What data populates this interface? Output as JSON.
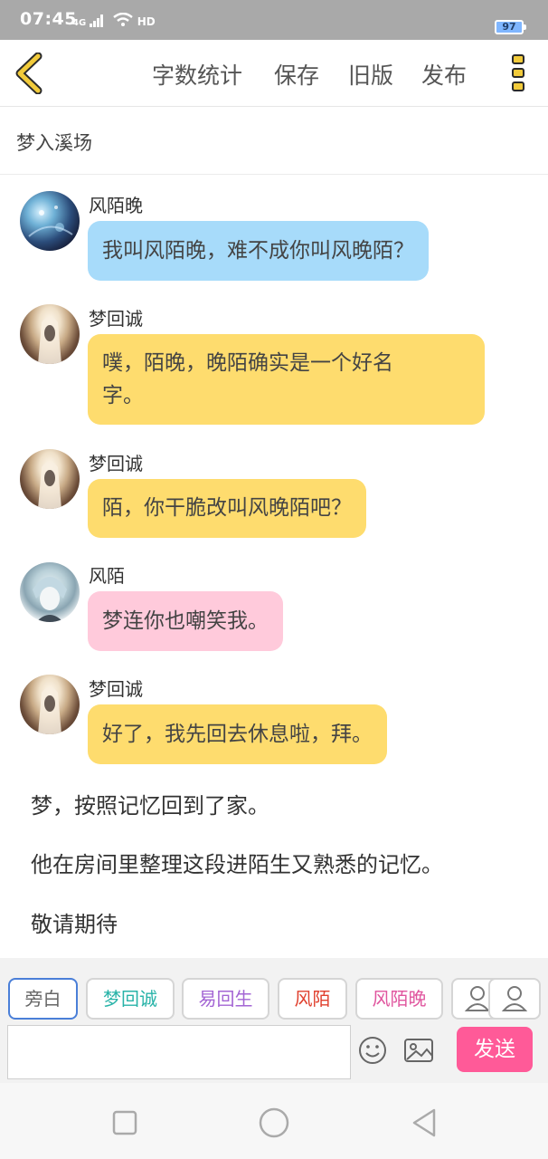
{
  "status_bar": {
    "time": "07:45",
    "network": "4G",
    "wifi_label": "HD",
    "battery": "97"
  },
  "toolbar": {
    "word_count_label": "字数统计",
    "save_label": "保存",
    "old_version_label": "旧版",
    "publish_label": "发布",
    "accent_color": "#f2cb3b"
  },
  "chapter": {
    "title": "梦入溪场"
  },
  "messages": [
    {
      "sender": "风陌晚",
      "text": "我叫风陌晚，难不成你叫风晚陌？",
      "bubble_color": "#a7dbfa"
    },
    {
      "sender": "梦回诚",
      "text_line1": "噗，陌晚，晚陌确实是一个好名",
      "text_line2": "字。",
      "bubble_color": "#fedc6e"
    },
    {
      "sender": "梦回诚",
      "text": "陌，你干脆改叫风晚陌吧？",
      "bubble_color": "#fedc6e"
    },
    {
      "sender": "风陌",
      "text": "梦连你也嘲笑我。",
      "bubble_color": "#ffcadb"
    },
    {
      "sender": "梦回诚",
      "text": "好了，我先回去休息啦，拜。",
      "bubble_color": "#fedc6e"
    }
  ],
  "narration": [
    "梦，按照记忆回到了家。",
    "他在房间里整理这段进陌生又熟悉的记忆。",
    "敬请期待"
  ],
  "characters": [
    {
      "label": "旁白",
      "color": "#666666",
      "selected": true
    },
    {
      "label": "梦回诚",
      "color": "#28b3a8"
    },
    {
      "label": "易回生",
      "color": "#a365d4"
    },
    {
      "label": "风陌",
      "color": "#e0402e"
    },
    {
      "label": "风陌晚",
      "color": "#e0559e"
    }
  ],
  "composer": {
    "input_value": "",
    "send_label": "发送",
    "send_color": "#ff5a98"
  }
}
